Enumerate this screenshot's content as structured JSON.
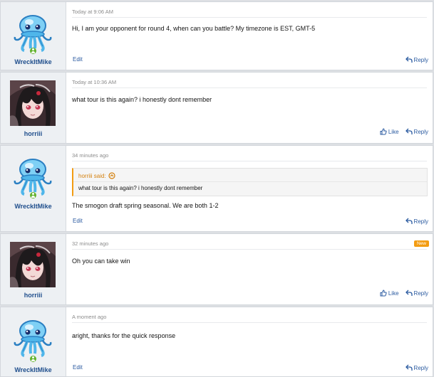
{
  "posts": [
    {
      "username": "WreckItMike",
      "date": "Today at 9:06 AM",
      "message": "Hi, I am your opponent for round 4, when can you battle? My timezone is EST, GMT-5",
      "edit_label": "Edit",
      "reply_label": "Reply",
      "online": true
    },
    {
      "username": "horriii",
      "date": "Today at 10:36 AM",
      "message": "what tour is this again? i honestly dont remember",
      "like_label": "Like",
      "reply_label": "Reply"
    },
    {
      "username": "WreckItMike",
      "date": "34 minutes ago",
      "quote": {
        "author": "horriii said:",
        "text": "what tour is this again? i honestly dont remember"
      },
      "message": "The smogon draft spring seasonal. We are both 1-2",
      "edit_label": "Edit",
      "reply_label": "Reply",
      "online": true
    },
    {
      "username": "horriii",
      "date": "32 minutes ago",
      "badge": "New",
      "message": "Oh you can take win",
      "like_label": "Like",
      "reply_label": "Reply"
    },
    {
      "username": "WreckItMike",
      "date": "A moment ago",
      "message": "aright, thanks for the quick response",
      "edit_label": "Edit",
      "reply_label": "Reply",
      "online": true
    }
  ],
  "colors": {
    "link": "#2a5aa0",
    "username": "#1f4e8c",
    "online": "#63b32e",
    "badge": "#f39c12"
  },
  "icons": {
    "jellyfish_avatar": "jellyfish-avatar",
    "anime_avatar": "anime-girl-avatar",
    "reply": "reply-arrow-icon",
    "like": "thumbs-up-icon",
    "quote": "chevron-up-circle-icon"
  }
}
